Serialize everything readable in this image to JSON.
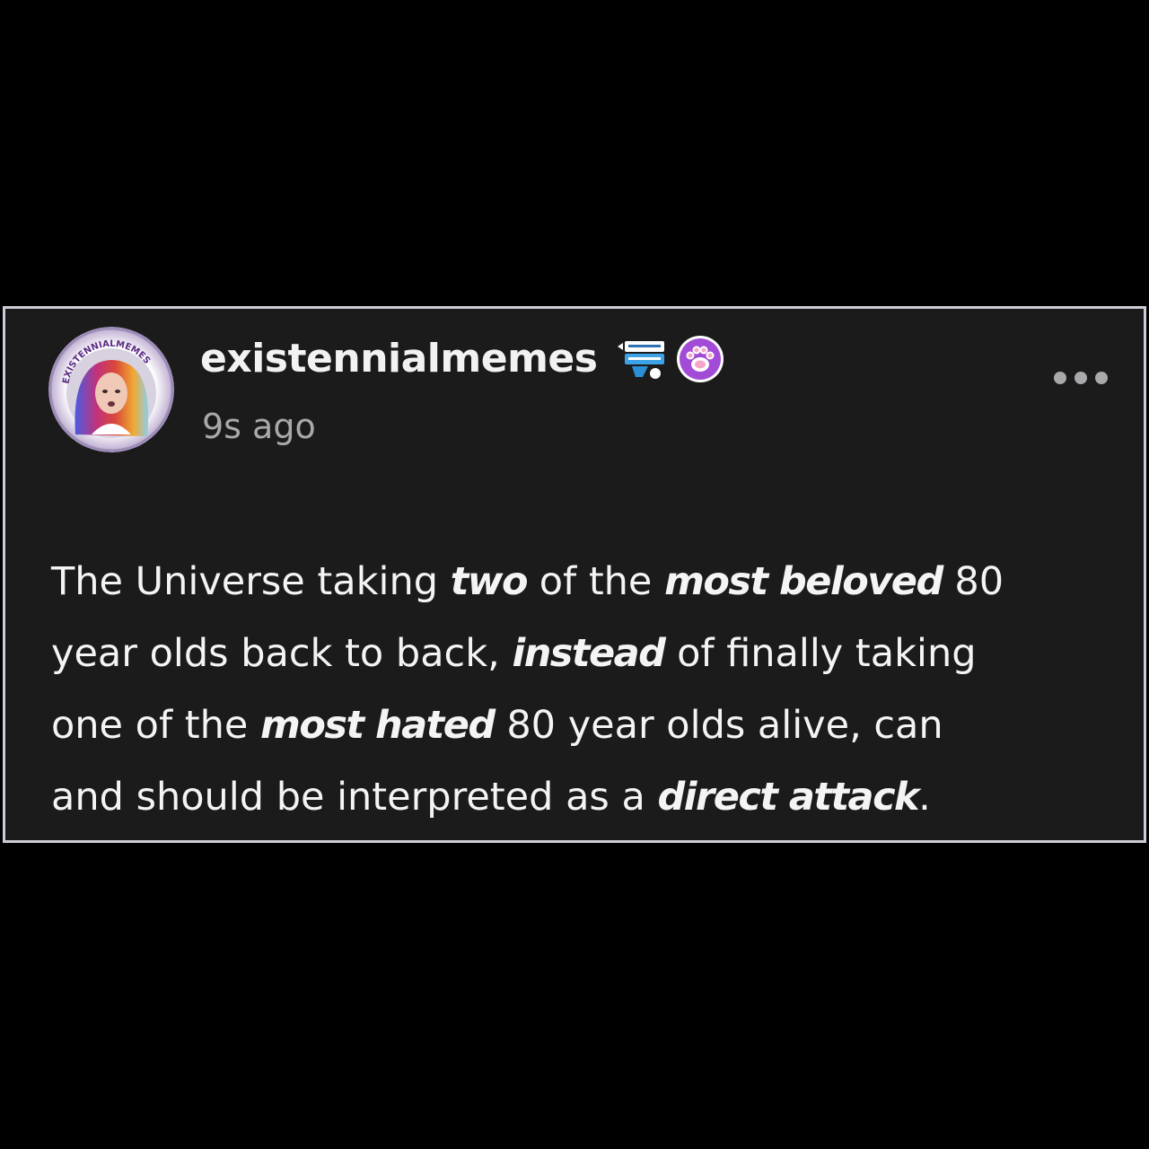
{
  "post": {
    "author": {
      "username": "existennialmemes",
      "avatar_ring_text": "EXISTENNIALMEMES",
      "badges": [
        "flag-badge-icon",
        "paw-badge-icon"
      ]
    },
    "timestamp": "9s ago",
    "body_lines": [
      [
        {
          "text": "The Universe taking ",
          "style": "normal"
        },
        {
          "text": "two",
          "style": "emphasis"
        },
        {
          "text": " of the ",
          "style": "normal"
        },
        {
          "text": "most beloved",
          "style": "emphasis"
        },
        {
          "text": " 80",
          "style": "normal"
        }
      ],
      [
        {
          "text": "year olds back to back, ",
          "style": "normal"
        },
        {
          "text": "instead",
          "style": "emphasis"
        },
        {
          "text": " of finally taking",
          "style": "normal"
        }
      ],
      [
        {
          "text": "one of the ",
          "style": "normal"
        },
        {
          "text": "most hated",
          "style": "emphasis"
        },
        {
          "text": " 80 year olds alive, can",
          "style": "normal"
        }
      ],
      [
        {
          "text": "and should be interpreted as a ",
          "style": "normal"
        },
        {
          "text": "direct attack",
          "style": "emphasis"
        },
        {
          "text": ".",
          "style": "normal"
        }
      ]
    ]
  },
  "colors": {
    "page_background": "#000000",
    "card_background": "#1c1b1c",
    "card_border": "#cfcbd6",
    "text_primary": "#f2f2f2",
    "text_secondary": "#a9a9ab",
    "paw_badge": "#a24bd6"
  }
}
